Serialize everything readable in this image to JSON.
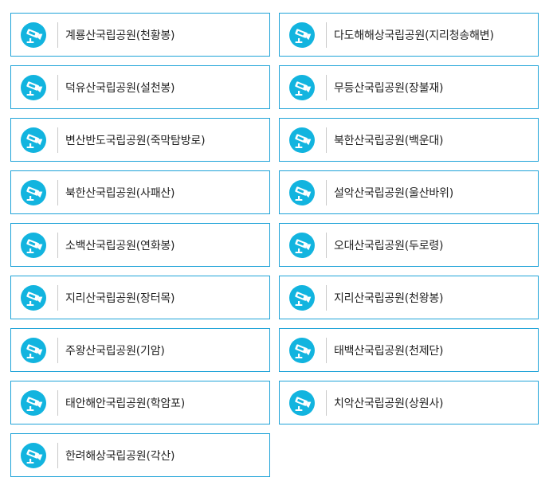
{
  "accent_color": "#12b4df",
  "border_color": "#1fa3d8",
  "item_icon": "cctv-camera-icon",
  "cameras": [
    {
      "label": "계룡산국립공원(천황봉)"
    },
    {
      "label": "다도해해상국립공원(지리청송해변)"
    },
    {
      "label": "덕유산국립공원(설천봉)"
    },
    {
      "label": "무등산국립공원(장불재)"
    },
    {
      "label": "변산반도국립공원(죽막탐방로)"
    },
    {
      "label": "북한산국립공원(백운대)"
    },
    {
      "label": "북한산국립공원(사패산)"
    },
    {
      "label": "설악산국립공원(울산바위)"
    },
    {
      "label": "소백산국립공원(연화봉)"
    },
    {
      "label": "오대산국립공원(두로령)"
    },
    {
      "label": "지리산국립공원(장터목)"
    },
    {
      "label": "지리산국립공원(천왕봉)"
    },
    {
      "label": "주왕산국립공원(기암)"
    },
    {
      "label": "태백산국립공원(천제단)"
    },
    {
      "label": "태안해안국립공원(학암포)"
    },
    {
      "label": "치악산국립공원(상원사)"
    },
    {
      "label": "한려해상국립공원(각산)"
    }
  ]
}
